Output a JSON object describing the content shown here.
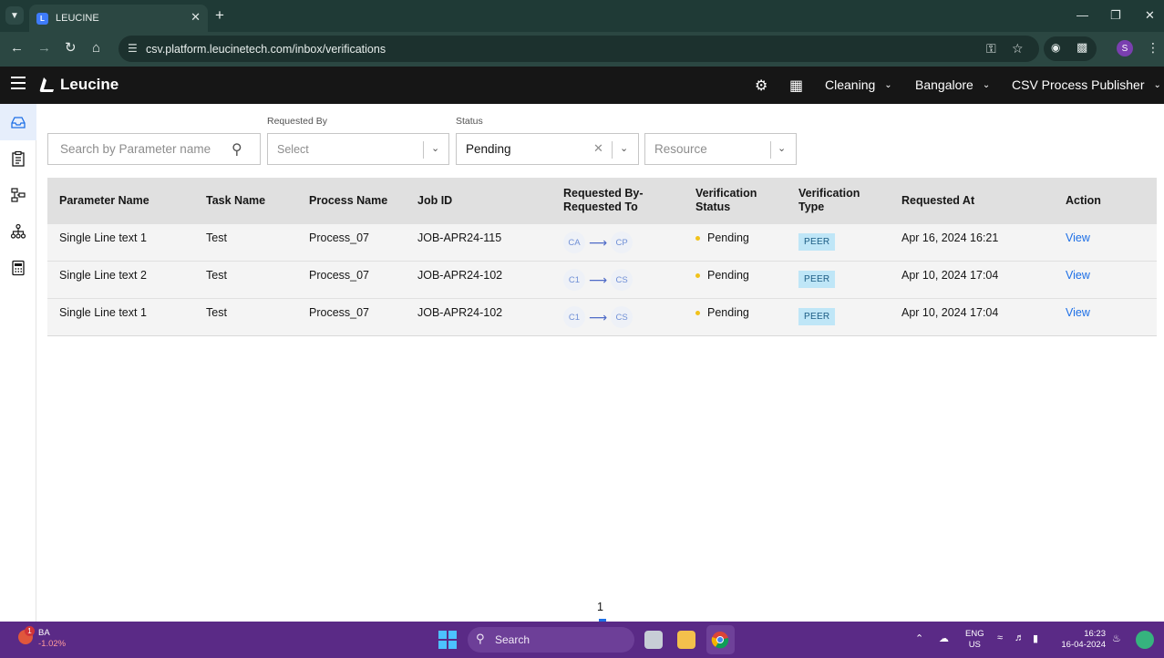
{
  "browser": {
    "tab_title": "LEUCINE",
    "url": "csv.platform.leucinetech.com/inbox/verifications",
    "profile_initial": "S"
  },
  "app": {
    "brand": "Leucine",
    "menus": [
      {
        "label": "Cleaning"
      },
      {
        "label": "Bangalore"
      },
      {
        "label": "CSV Process Publisher"
      }
    ]
  },
  "filters": {
    "search_placeholder": "Search by Parameter name",
    "requested_by_label": "Requested By",
    "requested_by_placeholder": "Select",
    "status_label": "Status",
    "status_value": "Pending",
    "resource_placeholder": "Resource"
  },
  "table": {
    "headers": {
      "parameter_name": "Parameter Name",
      "task_name": "Task Name",
      "process_name": "Process Name",
      "job_id": "Job ID",
      "requested_by_line1": "Requested By-",
      "requested_by_line2": "Requested To",
      "verification_status_line1": "Verification",
      "verification_status_line2": "Status",
      "verification_type_line1": "Verification",
      "verification_type_line2": "Type",
      "requested_at": "Requested At",
      "action": "Action"
    },
    "rows": [
      {
        "parameter": "Single Line text 1",
        "task": "Test",
        "process": "Process_07",
        "job": "JOB-APR24-115",
        "from": "CA",
        "to": "CP",
        "status": "Pending",
        "type": "PEER",
        "requested_at": "Apr 16, 2024 16:21",
        "action": "View"
      },
      {
        "parameter": "Single Line text 2",
        "task": "Test",
        "process": "Process_07",
        "job": "JOB-APR24-102",
        "from": "C1",
        "to": "CS",
        "status": "Pending",
        "type": "PEER",
        "requested_at": "Apr 10, 2024 17:04",
        "action": "View"
      },
      {
        "parameter": "Single Line text 1",
        "task": "Test",
        "process": "Process_07",
        "job": "JOB-APR24-102",
        "from": "C1",
        "to": "CS",
        "status": "Pending",
        "type": "PEER",
        "requested_at": "Apr 10, 2024 17:04",
        "action": "View"
      }
    ]
  },
  "pagination": {
    "current_page": "1"
  },
  "taskbar": {
    "ticker_name": "BA",
    "ticker_change": "-1.02%",
    "notification_count": "1",
    "search_label": "Search",
    "lang_line1": "ENG",
    "lang_line2": "US",
    "time": "16:23",
    "date": "16-04-2024"
  },
  "colors": {
    "accent": "#1d6fe6",
    "header_bg": "#161616",
    "pending_dot": "#f1c21b",
    "peer_tag_bg": "#bfe6f7"
  }
}
